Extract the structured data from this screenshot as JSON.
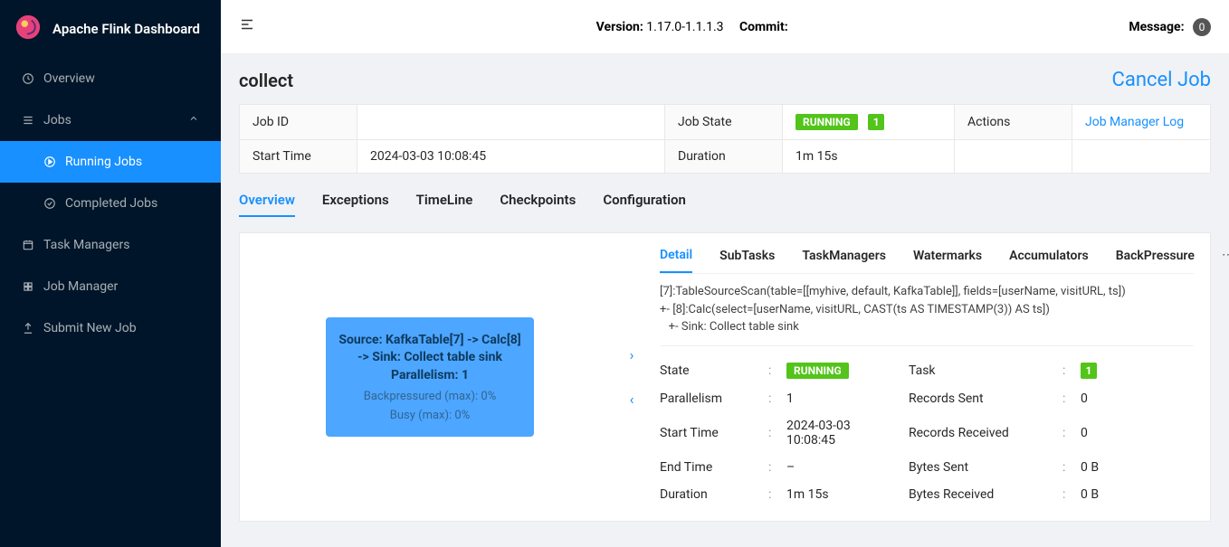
{
  "app_name": "Apache Flink Dashboard",
  "topbar": {
    "version_label": "Version:",
    "version": "1.17.0-1.1.1.3",
    "commit_label": "Commit:",
    "commit": "",
    "message_label": "Message:",
    "message_count": "0"
  },
  "sidebar": {
    "items": [
      {
        "label": "Overview"
      },
      {
        "label": "Jobs",
        "expanded": true,
        "children": [
          {
            "label": "Running Jobs",
            "active": true
          },
          {
            "label": "Completed Jobs"
          }
        ]
      },
      {
        "label": "Task Managers"
      },
      {
        "label": "Job Manager"
      },
      {
        "label": "Submit New Job"
      }
    ]
  },
  "job": {
    "title": "collect",
    "cancel_label": "Cancel Job",
    "info": {
      "job_id_label": "Job ID",
      "job_id": "",
      "job_state_label": "Job State",
      "job_state": "RUNNING",
      "job_state_count": "1",
      "actions_label": "Actions",
      "jobmanager_log_link": "Job Manager Log",
      "start_time_label": "Start Time",
      "start_time": "2024-03-03 10:08:45",
      "duration_label": "Duration",
      "duration": "1m 15s"
    },
    "tabs": [
      "Overview",
      "Exceptions",
      "TimeLine",
      "Checkpoints",
      "Configuration"
    ],
    "active_tab": "Overview"
  },
  "graph_node": {
    "line1": "Source: KafkaTable[7] -> Calc[8]",
    "line2": "-> Sink: Collect table sink",
    "parallelism_label": "Parallelism: 1",
    "bp": "Backpressured (max): 0%",
    "busy": "Busy (max): 0%"
  },
  "detail": {
    "tabs": [
      "Detail",
      "SubTasks",
      "TaskManagers",
      "Watermarks",
      "Accumulators",
      "BackPressure"
    ],
    "active_tab": "Detail",
    "plan_text": "[7]:TableSourceScan(table=[[myhive, default, KafkaTable]], fields=[userName, visitURL, ts])\n+- [8]:Calc(select=[userName, visitURL, CAST(ts AS TIMESTAMP(3)) AS ts])\n   +- Sink: Collect table sink",
    "kv": {
      "state_label": "State",
      "state": "RUNNING",
      "task_label": "Task",
      "task": "1",
      "parallelism_label": "Parallelism",
      "parallelism": "1",
      "records_sent_label": "Records Sent",
      "records_sent": "0",
      "start_time_label": "Start Time",
      "start_time": "2024-03-03 10:08:45",
      "records_received_label": "Records Received",
      "records_received": "0",
      "end_time_label": "End Time",
      "end_time": "–",
      "bytes_sent_label": "Bytes Sent",
      "bytes_sent": "0 B",
      "duration_label": "Duration",
      "duration": "1m 15s",
      "bytes_received_label": "Bytes Received",
      "bytes_received": "0 B"
    }
  }
}
